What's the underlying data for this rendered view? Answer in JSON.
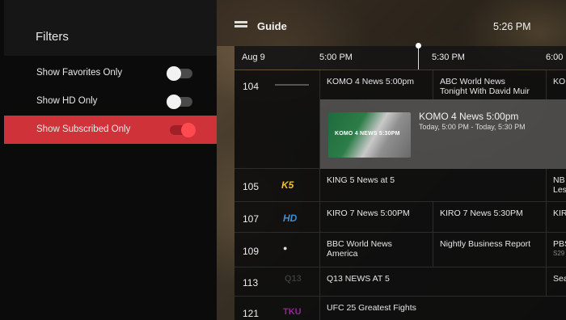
{
  "filters": {
    "title": "Filters",
    "items": [
      {
        "label": "Show Favorites Only",
        "state": "off"
      },
      {
        "label": "Show HD Only",
        "state": "off"
      },
      {
        "label": "Show Subscribed Only",
        "state": "on"
      }
    ]
  },
  "guide": {
    "title": "Guide",
    "clock": "5:26 PM",
    "date": "Aug 9",
    "times": [
      "5:00 PM",
      "5:30 PM",
      "6:00"
    ]
  },
  "channels": [
    {
      "number": "104",
      "logo": "",
      "programs": [
        "KOMO 4 News 5:00pm",
        "ABC World News",
        "KO"
      ],
      "program_sub": "Tonight With David Muir"
    },
    {
      "number": "105",
      "logo": "K5",
      "programs": [
        "KING 5 News at 5",
        "NB"
      ],
      "program_sub": "Les"
    },
    {
      "number": "107",
      "logo": "HD",
      "programs": [
        "KIRO 7 News 5:00PM",
        "KIRO 7 News 5:30PM",
        "KIR"
      ]
    },
    {
      "number": "109",
      "logo": "",
      "programs": [
        "BBC World News",
        "Nightly Business Report",
        "PBS"
      ],
      "program_sub": "America",
      "last_sub": "S29"
    },
    {
      "number": "113",
      "logo": "Q13",
      "programs": [
        "Q13 NEWS AT 5",
        "Sea"
      ]
    },
    {
      "number": "121",
      "logo": "TKU",
      "programs": [
        "UFC 25 Greatest Fights"
      ]
    }
  ],
  "detail": {
    "thumb_text": "KOMO 4 NEWS 5:30PM",
    "title": "KOMO 4 News 5:00pm",
    "time": "Today, 5:00 PM - Today, 5:30 PM"
  },
  "colors": {
    "accent": "#d0323a",
    "toggle_on": "#ff4b50"
  }
}
